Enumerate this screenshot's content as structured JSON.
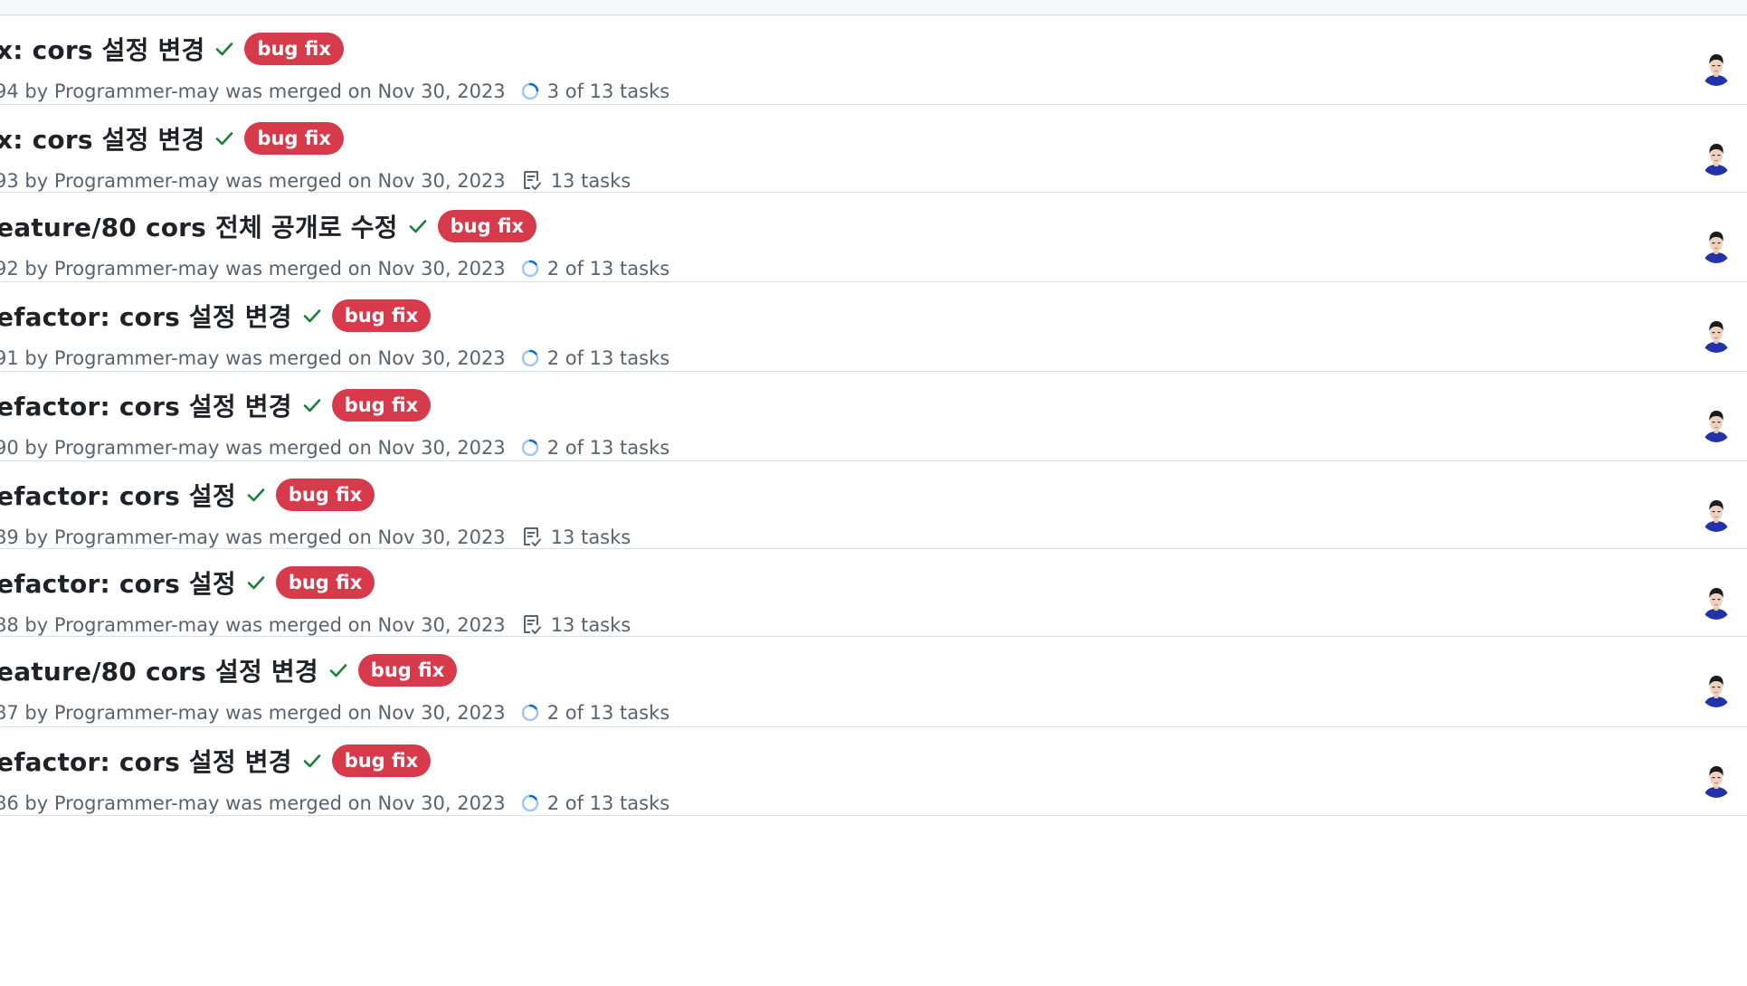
{
  "pull_requests": [
    {
      "title": "x: cors 설정 변경",
      "label": "bug fix",
      "meta": "94 by Programmer-may was merged on Nov 30, 2023",
      "tasks": "3 of 13 tasks",
      "task_icon": "progress-icon",
      "progress": 0.23
    },
    {
      "title": "x: cors 설정 변경",
      "label": "bug fix",
      "meta": "93 by Programmer-may was merged on Nov 30, 2023",
      "tasks": "13 tasks",
      "task_icon": "checklist-icon"
    },
    {
      "title": "eature/80 cors 전체 공개로 수정",
      "label": "bug fix",
      "meta": "92 by Programmer-may was merged on Nov 30, 2023",
      "tasks": "2 of 13 tasks",
      "task_icon": "progress-icon",
      "progress": 0.15
    },
    {
      "title": "efactor: cors 설정 변경",
      "label": "bug fix",
      "meta": "91 by Programmer-may was merged on Nov 30, 2023",
      "tasks": "2 of 13 tasks",
      "task_icon": "progress-icon",
      "progress": 0.15
    },
    {
      "title": "efactor: cors 설정 변경",
      "label": "bug fix",
      "meta": "90 by Programmer-may was merged on Nov 30, 2023",
      "tasks": "2 of 13 tasks",
      "task_icon": "progress-icon",
      "progress": 0.15
    },
    {
      "title": "efactor: cors 설정",
      "label": "bug fix",
      "meta": "89 by Programmer-may was merged on Nov 30, 2023",
      "tasks": "13 tasks",
      "task_icon": "checklist-icon"
    },
    {
      "title": "efactor: cors 설정",
      "label": "bug fix",
      "meta": "88 by Programmer-may was merged on Nov 30, 2023",
      "tasks": "13 tasks",
      "task_icon": "checklist-icon"
    },
    {
      "title": "eature/80 cors 설정 변경",
      "label": "bug fix",
      "meta": "87 by Programmer-may was merged on Nov 30, 2023",
      "tasks": "2 of 13 tasks",
      "task_icon": "progress-icon",
      "progress": 0.15
    },
    {
      "title": "efactor: cors 설정 변경",
      "label": "bug fix",
      "meta": "86 by Programmer-may was merged on Nov 30, 2023",
      "tasks": "2 of 13 tasks",
      "task_icon": "progress-icon",
      "progress": 0.15
    }
  ],
  "colors": {
    "label_bg": "#d73a4a",
    "check": "#1a7f37",
    "progress": "#0969da"
  }
}
